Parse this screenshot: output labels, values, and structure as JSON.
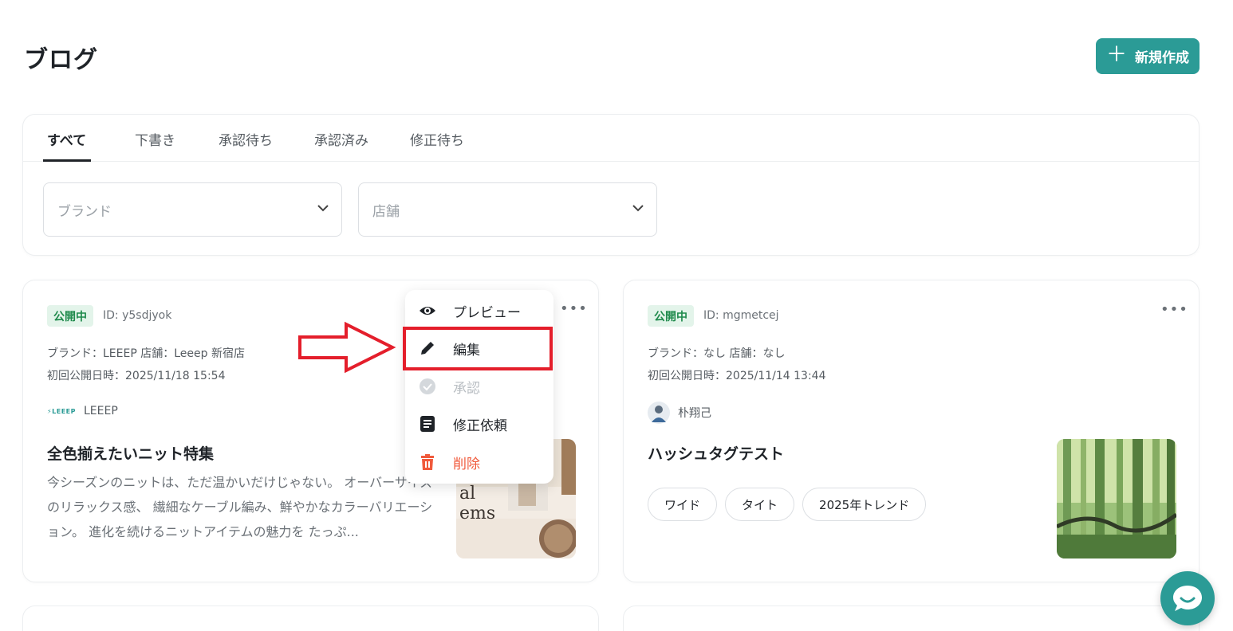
{
  "page": {
    "title": "ブログ"
  },
  "header": {
    "new_button_label": "新規作成"
  },
  "tabs": [
    {
      "label": "すべて",
      "active": true
    },
    {
      "label": "下書き"
    },
    {
      "label": "承認待ち"
    },
    {
      "label": "承認済み"
    },
    {
      "label": "修正待ち"
    }
  ],
  "filters": {
    "brand_placeholder": "ブランド",
    "store_placeholder": "店舗"
  },
  "posts": [
    {
      "status": "公開中",
      "id_text": "ID: y5sdjyok",
      "brand_store": "ブランド：LEEEP  店舗：Leeep 新宿店",
      "published": "初回公開日時：2025/11/18 15:54",
      "author": "LEEEP",
      "author_logo_text": "LEEEP",
      "title": "全色揃えたいニット特集",
      "excerpt": "今シーズンのニットは、ただ温かいだけじゃない。 オーバーサイズのリラックス感、 繊細なケーブル編み、鮮やかなカラーバリエーション。 進化を続けるニットアイテムの魅力を たっぷ..."
    },
    {
      "status": "公開中",
      "id_text": "ID: mgmetcej",
      "brand_store": "ブランド：なし  店舗：なし",
      "published": "初回公開日時：2025/11/14 13:44",
      "author": "朴翔己",
      "title": "ハッシュタグテスト",
      "tags": [
        "ワイド",
        "タイト",
        "2025年トレンド"
      ]
    }
  ],
  "menu": {
    "items": [
      {
        "label": "プレビュー",
        "icon": "eye-icon"
      },
      {
        "label": "編集",
        "icon": "pencil-icon"
      },
      {
        "label": "承認",
        "icon": "check-circle-icon",
        "disabled": true
      },
      {
        "label": "修正依頼",
        "icon": "document-icon"
      },
      {
        "label": "削除",
        "icon": "trash-icon",
        "danger": true
      }
    ]
  },
  "thumb_text": {
    "line1": "al",
    "line2": "ems"
  },
  "colors": {
    "accent": "#2b9b96",
    "badge_bg": "#e3f4ea",
    "badge_text": "#1f8a4c",
    "danger": "#f05a3c",
    "highlight": "#e41e2b"
  }
}
